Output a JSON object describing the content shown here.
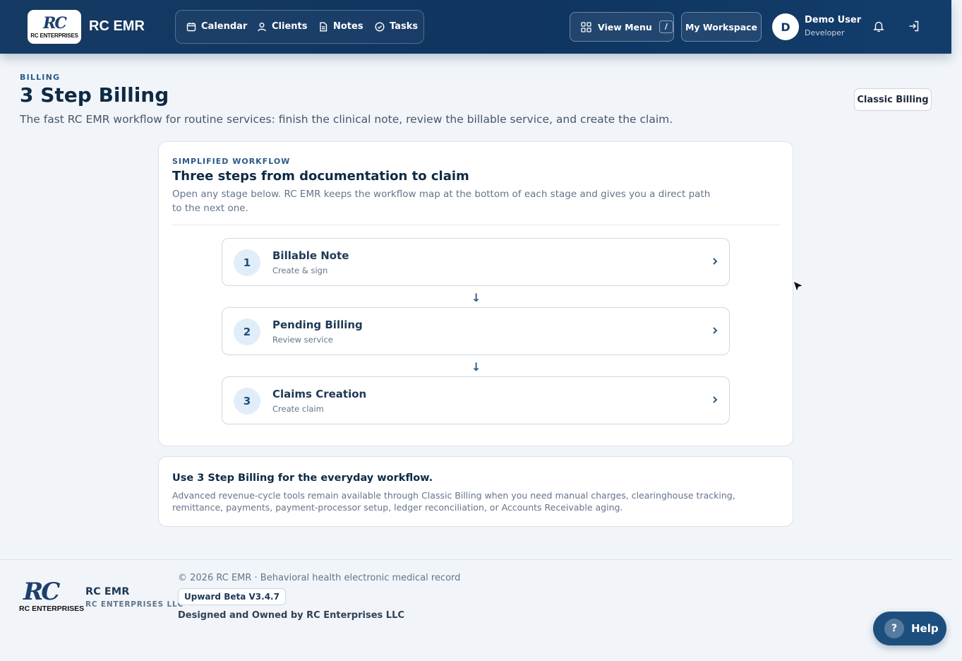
{
  "header": {
    "logo_mark": "RC",
    "logo_sub": "RC ENTERPRISES",
    "brand": "RC EMR",
    "nav": [
      {
        "label": "Calendar",
        "icon": "calendar-icon"
      },
      {
        "label": "Clients",
        "icon": "user-icon"
      },
      {
        "label": "Notes",
        "icon": "document-icon"
      },
      {
        "label": "Tasks",
        "icon": "check-circle-icon"
      }
    ],
    "view_menu_label": "View Menu",
    "view_menu_shortcut": "/",
    "workspace_label": "My Workspace",
    "user": {
      "initial": "D",
      "name": "Demo User",
      "role": "Developer"
    }
  },
  "page": {
    "eyebrow": "BILLING",
    "title": "3 Step Billing",
    "description": "The fast RC EMR workflow for routine services: finish the clinical note, review the billable service, and create the claim.",
    "classic_button": "Classic Billing"
  },
  "workflow": {
    "eyebrow": "SIMPLIFIED WORKFLOW",
    "title": "Three steps from documentation to claim",
    "description": "Open any stage below. RC EMR keeps the workflow map at the bottom of each stage and gives you a direct path to the next one.",
    "steps": [
      {
        "num": "1",
        "title": "Billable Note",
        "sub": "Create & sign"
      },
      {
        "num": "2",
        "title": "Pending Billing",
        "sub": "Review service"
      },
      {
        "num": "3",
        "title": "Claims Creation",
        "sub": "Create claim"
      }
    ],
    "arrow": "↓"
  },
  "info": {
    "title": "Use 3 Step Billing for the everyday workflow.",
    "description": "Advanced revenue-cycle tools remain available through Classic Billing when you need manual charges, clearinghouse tracking, remittance, payments, payment-processor setup, ledger reconciliation, or Accounts Receivable aging."
  },
  "footer": {
    "logo_mark": "RC",
    "logo_sub": "RC ENTERPRISES",
    "brand": "RC EMR",
    "company": "RC ENTERPRISES LLC",
    "copyright": "© 2026 RC EMR · Behavioral health electronic medical record",
    "version": "Upward Beta V3.4.7",
    "owned": "Designed and Owned by RC Enterprises LLC"
  },
  "help": {
    "label": "Help",
    "icon_text": "?"
  }
}
